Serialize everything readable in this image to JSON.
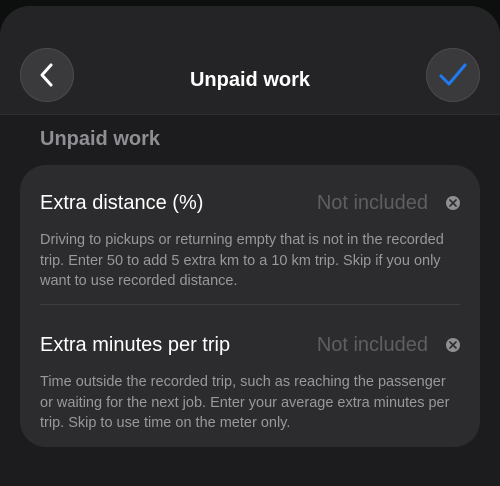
{
  "nav": {
    "title": "Unpaid work",
    "back_icon": "chevron-left-icon",
    "done_icon": "checkmark-icon",
    "accent": "#1e7bf2"
  },
  "section": {
    "title": "Unpaid work"
  },
  "fields": [
    {
      "label": "Extra distance (%)",
      "placeholder": "Not included",
      "description": "Driving to pickups or returning empty that is not in the recorded trip. Enter 50 to add 5 extra km to a 10 km trip. Skip if you only want to use recorded distance."
    },
    {
      "label": "Extra minutes per trip",
      "placeholder": "Not included",
      "description": "Time outside the recorded trip, such as reaching the passenger or waiting for the next job. Enter your average extra minutes per trip. Skip to use time on the meter only."
    }
  ]
}
